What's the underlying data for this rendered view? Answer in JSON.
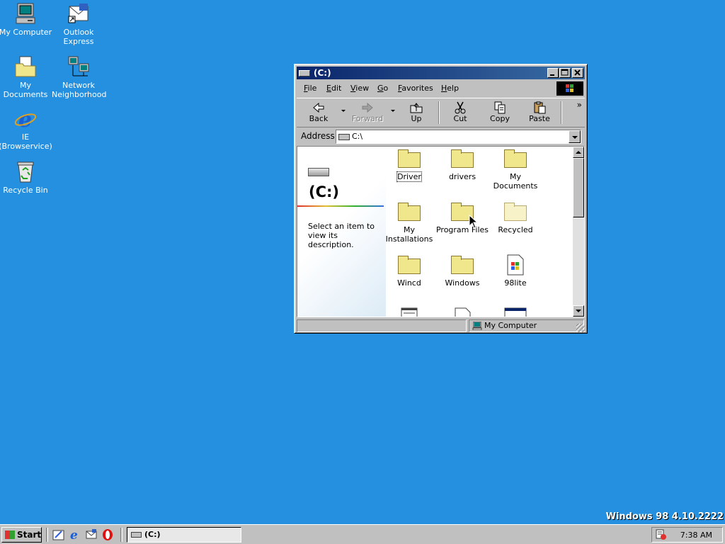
{
  "desktop": {
    "background": "#2490df",
    "icons": [
      {
        "label": "My Computer",
        "icon": "my-computer-icon"
      },
      {
        "label": "Outlook Express",
        "icon": "outlook-express-icon"
      },
      {
        "label": "My Documents",
        "icon": "my-documents-icon"
      },
      {
        "label": "Network Neighborhood",
        "icon": "network-neighborhood-icon"
      },
      {
        "label": "IE (Browservice)",
        "icon": "internet-explorer-icon"
      },
      {
        "label": "Recycle Bin",
        "icon": "recycle-bin-icon"
      }
    ],
    "version_text": "Windows 98 4.10.2222"
  },
  "window": {
    "title": "(C:)",
    "title_bar_color": "#0a246a",
    "menu": [
      {
        "label": "File",
        "underline": "F",
        "rest": "ile"
      },
      {
        "label": "Edit",
        "underline": "E",
        "rest": "dit"
      },
      {
        "label": "View",
        "underline": "V",
        "rest": "iew"
      },
      {
        "label": "Go",
        "underline": "G",
        "rest": "o"
      },
      {
        "label": "Favorites",
        "underline": "F",
        "rest": "avorites"
      },
      {
        "label": "Help",
        "underline": "H",
        "rest": "elp"
      }
    ],
    "toolbar": {
      "back": "Back",
      "forward": "Forward",
      "up": "Up",
      "cut": "Cut",
      "copy": "Copy",
      "paste": "Paste",
      "more": "»"
    },
    "address": {
      "label": "Address",
      "value": "C:\\"
    },
    "left_pane": {
      "heading": "(C:)",
      "description": "Select an item to view its description."
    },
    "items": [
      {
        "label": "Driver",
        "type": "folder"
      },
      {
        "label": "drivers",
        "type": "folder"
      },
      {
        "label": "My Documents",
        "type": "folder"
      },
      {
        "label": "My Installations",
        "type": "folder"
      },
      {
        "label": "Program Files",
        "type": "folder"
      },
      {
        "label": "Recycled",
        "type": "folder-hidden"
      },
      {
        "label": "Wincd",
        "type": "folder"
      },
      {
        "label": "Windows",
        "type": "folder"
      },
      {
        "label": "98lite",
        "type": "application"
      }
    ],
    "status": {
      "zone": "My Computer"
    }
  },
  "taskbar": {
    "start_label": "Start",
    "task_title": "(C:)",
    "clock": "7:38 AM"
  }
}
